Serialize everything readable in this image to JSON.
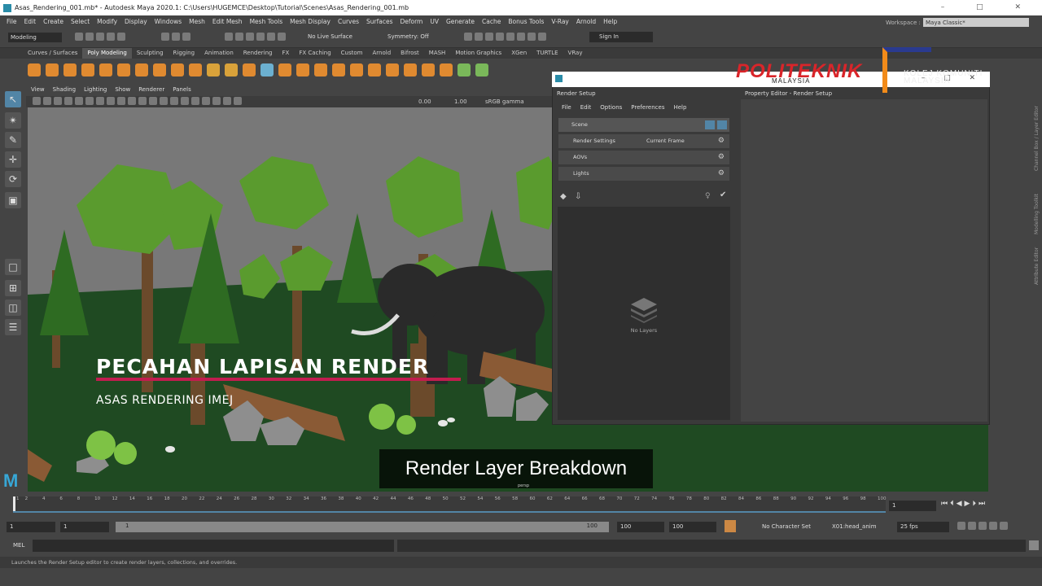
{
  "window": {
    "title": "Asas_Rendering_001.mb* - Autodesk Maya 2020.1: C:\\Users\\HUGEMCE\\Desktop\\Tutorial\\Scenes\\Asas_Rendering_001.mb",
    "controls": "– □ ✕"
  },
  "menubar": [
    "File",
    "Edit",
    "Create",
    "Select",
    "Modify",
    "Display",
    "Windows",
    "Mesh",
    "Edit Mesh",
    "Mesh Tools",
    "Mesh Display",
    "Curves",
    "Surfaces",
    "Deform",
    "UV",
    "Generate",
    "Cache",
    "Bonus Tools",
    "V-Ray",
    "Arnold",
    "Help"
  ],
  "statusline": {
    "mode": "Modeling",
    "live_surface": "No Live Surface",
    "symmetry": "Symmetry: Off",
    "sign_in": "Sign In",
    "workspace_label": "Workspace :",
    "workspace_value": "Maya Classic*"
  },
  "shelf_tabs": [
    "Curves / Surfaces",
    "Poly Modeling",
    "Sculpting",
    "Rigging",
    "Animation",
    "Rendering",
    "FX",
    "FX Caching",
    "Custom",
    "Arnold",
    "Bifrost",
    "MASH",
    "Motion Graphics",
    "XGen",
    "TURTLE",
    "VRay"
  ],
  "shelf_active": "Poly Modeling",
  "viewport": {
    "menu": [
      "View",
      "Shading",
      "Lighting",
      "Show",
      "Renderer",
      "Panels"
    ],
    "exposure": "0.00",
    "gamma": "1.00",
    "colorspace": "sRGB gamma",
    "camera_label": "persp"
  },
  "overlay": {
    "title": "PECAHAN LAPISAN RENDER",
    "subtitle": "ASAS RENDERING IMEJ",
    "caption": "Render Layer Breakdown",
    "underline_color": "#c21d4f"
  },
  "branding": {
    "logo1": "POLITEKNIK",
    "logo1_sub": "MALAYSIA",
    "logo2_line1": "KOLEJ KOMUNITI",
    "logo2_line2": "MALAYSIA"
  },
  "render_setup": {
    "window_title": "Render Setup",
    "menu": [
      "File",
      "Edit",
      "Options",
      "Preferences",
      "Help"
    ],
    "scene_label": "Scene",
    "rows": [
      {
        "label": "Render Settings",
        "value": "Current Frame"
      },
      {
        "label": "AOVs",
        "value": ""
      },
      {
        "label": "Lights",
        "value": ""
      }
    ],
    "empty_label": "No Layers",
    "property_editor_title": "Property Editor - Render Setup"
  },
  "side_tabs": [
    "Channel Box / Layer Editor",
    "Modelling Toolkit",
    "Attribute Editor"
  ],
  "timeline": {
    "ticks": [
      "1",
      "2",
      "4",
      "6",
      "8",
      "10",
      "12",
      "14",
      "16",
      "18",
      "20",
      "22",
      "24",
      "26",
      "28",
      "30",
      "32",
      "34",
      "36",
      "38",
      "40",
      "42",
      "44",
      "46",
      "48",
      "50",
      "52",
      "54",
      "56",
      "58",
      "60",
      "62",
      "64",
      "66",
      "68",
      "70",
      "72",
      "74",
      "76",
      "78",
      "80",
      "82",
      "84",
      "86",
      "88",
      "90",
      "92",
      "94",
      "96",
      "98",
      "100"
    ],
    "current_frame": "1"
  },
  "range": {
    "start": "1",
    "start_inner": "1",
    "slider_start": "1",
    "slider_end": "100",
    "end_inner": "100",
    "end": "100",
    "character_set": "No Character Set",
    "anim_layer": "X01:head_anim",
    "fps": "25 fps"
  },
  "cmdline": {
    "label": "MEL"
  },
  "helpline": "Launches the Render Setup editor to create render layers, collections, and overrides.",
  "colors": {
    "maya_grey": "#444444",
    "maya_blue": "#5285a6",
    "ground": "#1d4a1f",
    "tree": "#5a9b2e"
  }
}
